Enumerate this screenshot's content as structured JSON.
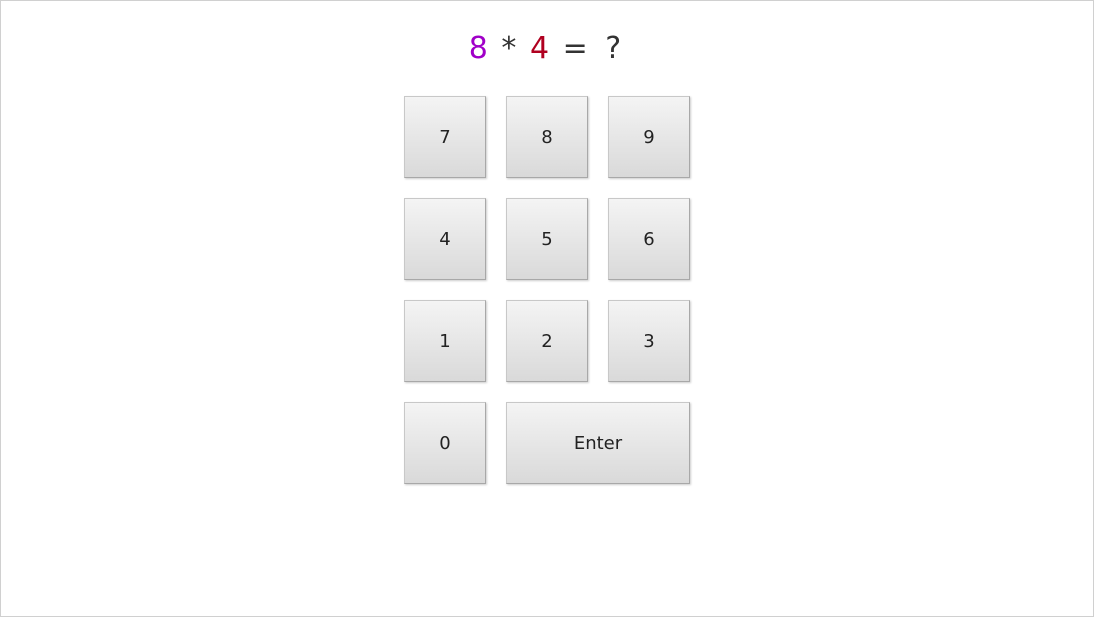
{
  "question": {
    "operand1": "8",
    "operator": "*",
    "operand2": "4",
    "equals": "=",
    "answer_placeholder": "?"
  },
  "keypad": {
    "k7": "7",
    "k8": "8",
    "k9": "9",
    "k4": "4",
    "k5": "5",
    "k6": "6",
    "k1": "1",
    "k2": "2",
    "k3": "3",
    "k0": "0",
    "enter": "Enter"
  },
  "colors": {
    "operand1": "#a000c8",
    "operand2": "#b00020"
  }
}
